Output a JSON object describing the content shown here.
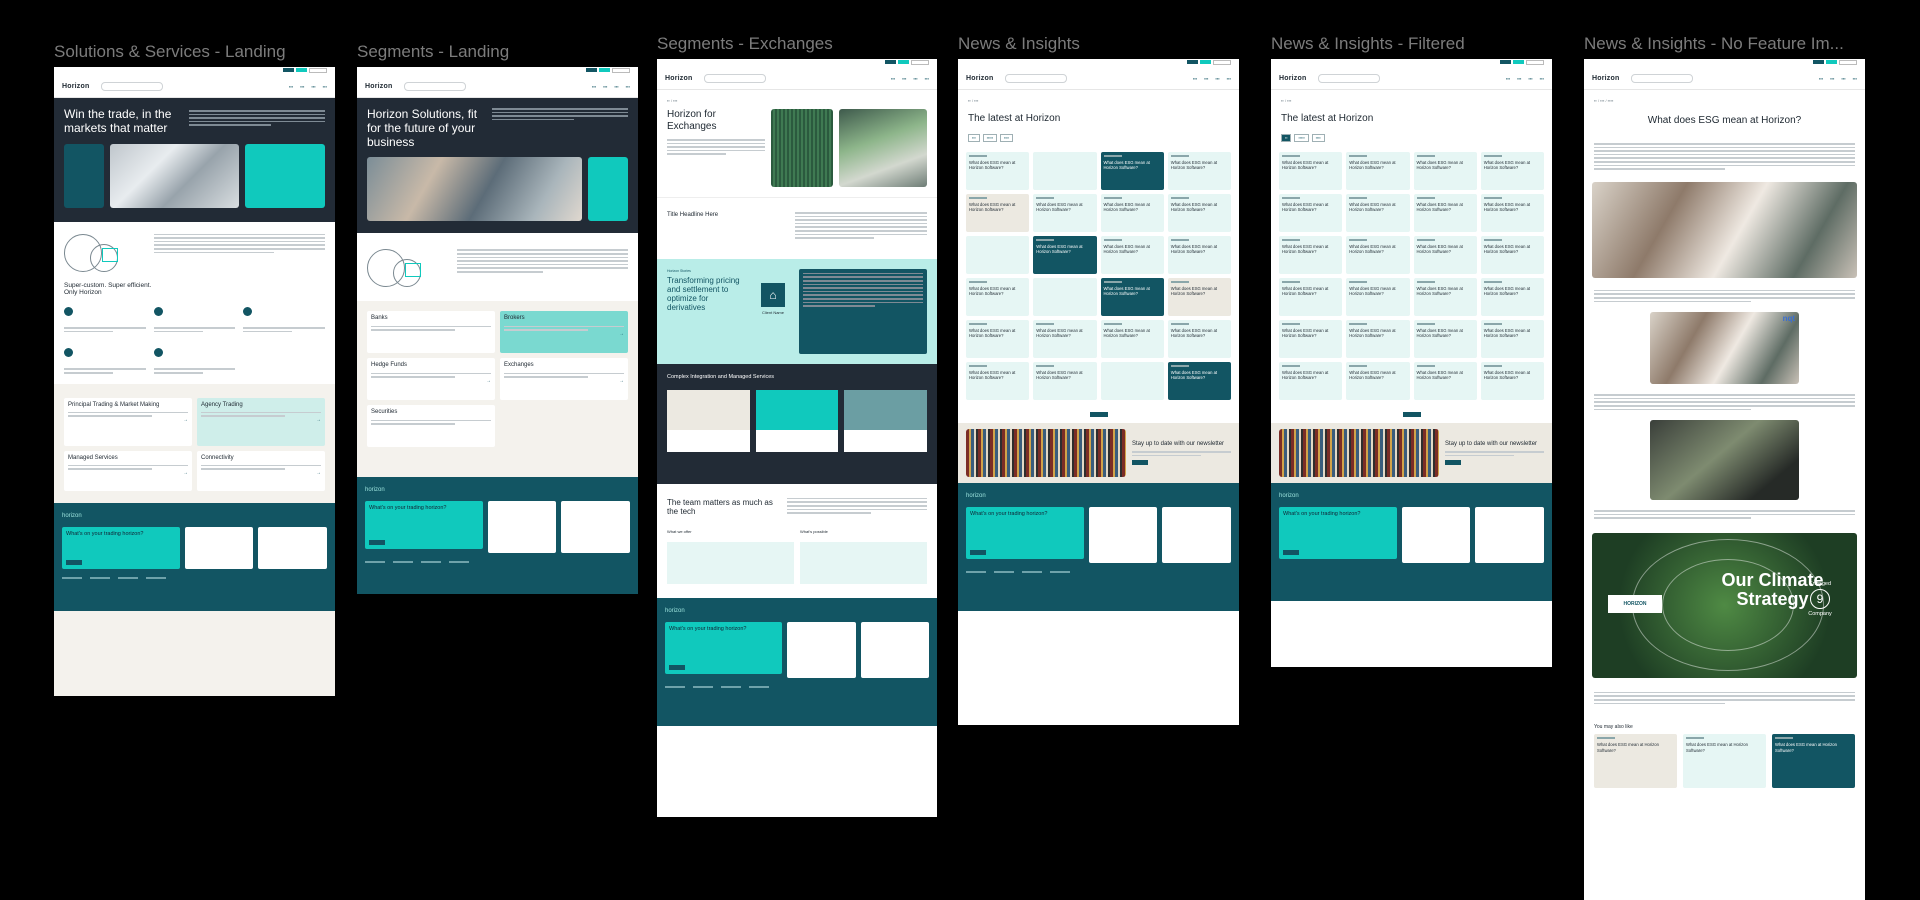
{
  "frames": [
    {
      "title": "Solutions & Services - Landing"
    },
    {
      "title": "Segments - Landing"
    },
    {
      "title": "Segments - Exchanges"
    },
    {
      "title": "News & Insights"
    },
    {
      "title": "News & Insights - Filtered"
    },
    {
      "title": "News & Insights - No Feature Im..."
    }
  ],
  "brand": {
    "logo": "Horizon",
    "footer_logo": "horizon"
  },
  "colors": {
    "navy": "#125563",
    "teal": "#10c9bd",
    "dark": "#222b36",
    "mint": "#e6f6f4"
  },
  "f1": {
    "hero_title": "Win the trade, in the markets that matter",
    "tagline": "Super-custom. Super efficient. Only Horizon",
    "cards": [
      {
        "label": "Principal Trading & Market Making"
      },
      {
        "label": "Agency Trading"
      },
      {
        "label": "Managed Services"
      },
      {
        "label": "Connectivity"
      }
    ]
  },
  "f2": {
    "hero_title": "Horizon Solutions, fit for the future of your business",
    "cards": [
      {
        "label": "Banks"
      },
      {
        "label": "Brokers"
      },
      {
        "label": "Hedge Funds"
      },
      {
        "label": "Exchanges"
      },
      {
        "label": "Securities"
      }
    ]
  },
  "f3": {
    "hero_title": "Horizon for Exchanges",
    "headline": "Title Headline Here",
    "case_title": "Transforming pricing and settlement to optimize for derivatives",
    "client_name": "Client Name",
    "section_title": "Complex Integration and Managed Services",
    "team_title": "The team matters as much as the tech",
    "col_a": "What we offer",
    "col_b": "What's possible"
  },
  "f4": {
    "title": "The latest at Horizon",
    "cta_title": "Stay up to date with our newsletter"
  },
  "f5": {
    "title": "The latest at Horizon",
    "cta_title": "Stay up to date with our newsletter"
  },
  "f6": {
    "title": "What does ESG mean at Horizon?",
    "climate_title": "Our Climate Strategy",
    "climate_logo": "HORIZON",
    "engaged": "Engaged",
    "engaged_num": "9",
    "engaged_sub": "Company",
    "also_like": "You may also like",
    "tag": "nqt"
  },
  "footer": {
    "cta": "What's on your trading horizon?"
  },
  "news_card_text": "What does ESG mean at Horizon Software?"
}
